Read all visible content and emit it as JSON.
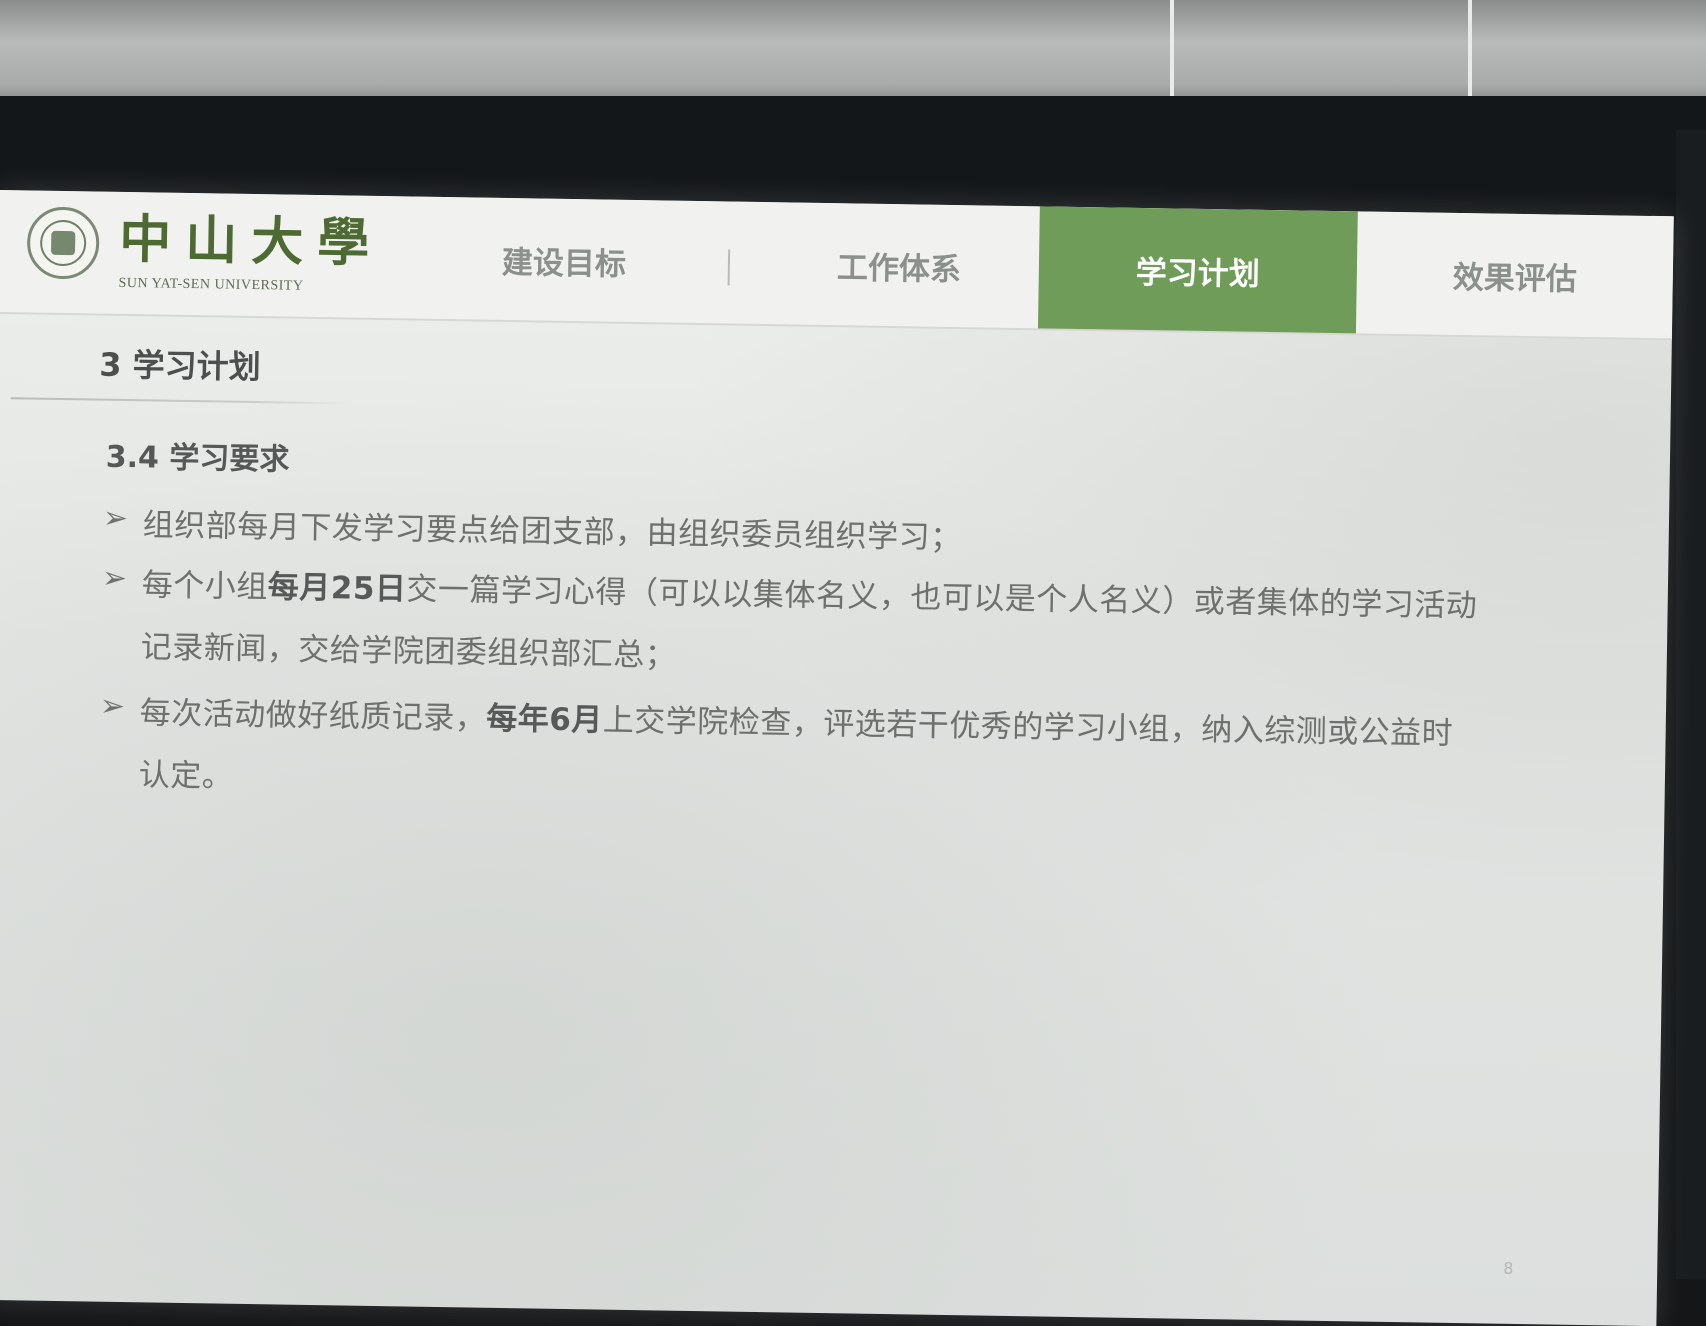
{
  "logo": {
    "cn": "中山大學",
    "en": "SUN YAT-SEN UNIVERSITY"
  },
  "nav": {
    "tabs": [
      {
        "label": "建设目标"
      },
      {
        "label": "工作体系"
      },
      {
        "label": "学习计划"
      },
      {
        "label": "效果评估"
      }
    ]
  },
  "slide": {
    "section_title": "3 学习计划",
    "sub_title": "3.4 学习要求",
    "bullets": [
      {
        "parts": [
          {
            "text": "组织部每月下发学习要点给团支部，由组织委员组织学习；",
            "bold": false
          }
        ]
      },
      {
        "parts": [
          {
            "text": "每个小组",
            "bold": false
          },
          {
            "text": "每月25日",
            "bold": true
          },
          {
            "text": "交一篇学习心得（可以以集体名义，也可以是个人名义）或者集体的学习活动记录新闻，交给学院团委组织部汇总；",
            "bold": false
          }
        ]
      },
      {
        "parts": [
          {
            "text": "每次活动做好纸质记录，",
            "bold": false
          },
          {
            "text": "每年6月",
            "bold": true
          },
          {
            "text": "上交学院检查，评选若干优秀的学习小组，纳入综测或公益时认定。",
            "bold": false
          }
        ]
      }
    ],
    "page_number": "8"
  },
  "colors": {
    "accent_green": "#6f9c58",
    "logo_green": "#4e6a33",
    "text_gray": "#6d706d"
  }
}
